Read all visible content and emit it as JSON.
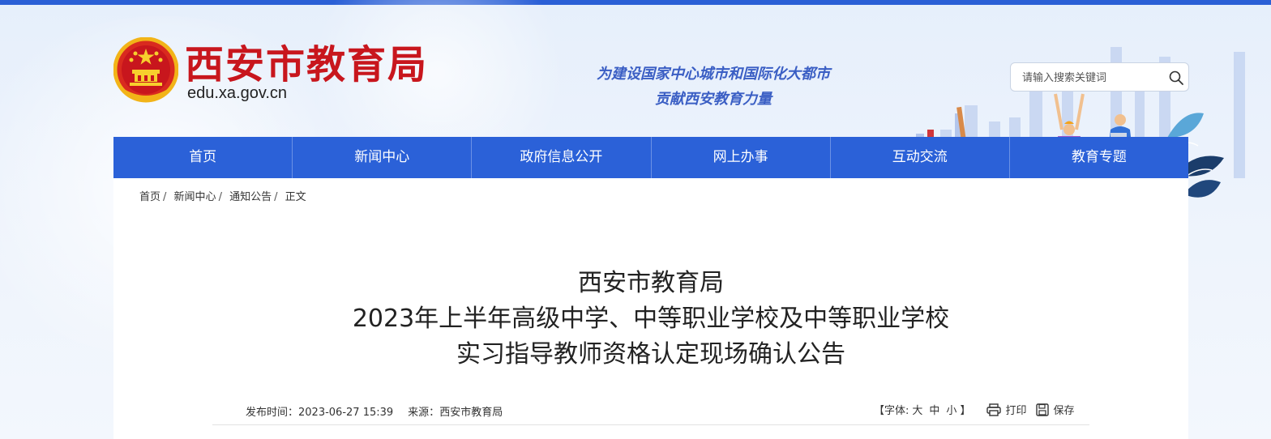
{
  "header": {
    "site_name": "西安市教育局",
    "domain": "edu.xa.gov.cn",
    "slogan_line1": "为建设国家中心城市和国际化大都市",
    "slogan_line2": "贡献西安教育力量",
    "search_placeholder": "请输入搜索关键词"
  },
  "nav": {
    "items": [
      {
        "label": "首页"
      },
      {
        "label": "新闻中心"
      },
      {
        "label": "政府信息公开"
      },
      {
        "label": "网上办事"
      },
      {
        "label": "互动交流"
      },
      {
        "label": "教育专题"
      }
    ]
  },
  "breadcrumb": {
    "items": [
      {
        "label": "首页"
      },
      {
        "label": "新闻中心"
      },
      {
        "label": "通知公告"
      },
      {
        "label": "正文"
      }
    ],
    "separator": "/"
  },
  "article": {
    "title_line1": "西安市教育局",
    "title_line2": "2023年上半年高级中学、中等职业学校及中等职业学校",
    "title_line3": "实习指导教师资格认定现场确认公告",
    "publish_label": "发布时间：",
    "publish_time": "2023-06-27 15:39",
    "source_label": "来源：",
    "source": "西安市教育局",
    "font_size_open": "【字体:",
    "font_large": "大",
    "font_medium": "中",
    "font_small": "小",
    "font_size_close": "】",
    "print_label": "打印",
    "save_label": "保存"
  },
  "colors": {
    "top_bar": "#2a5fd6",
    "nav_bg": "#2b61d8",
    "site_name": "#c8161d",
    "slogan": "#3a5ec4"
  },
  "icons": {
    "emblem": "national-emblem-icon",
    "search": "search-icon",
    "print": "printer-icon",
    "save": "floppy-disk-icon"
  }
}
